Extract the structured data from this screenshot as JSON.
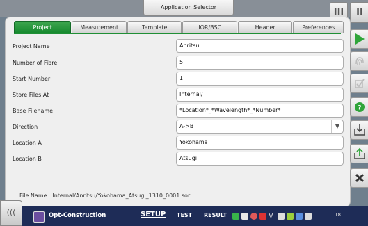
{
  "window": {
    "title": "Application Selector"
  },
  "corner_buttons": [
    {
      "icon": "pause-bars-icon",
      "glyph": "III"
    },
    {
      "icon": "pause-bars-icon",
      "glyph": "II"
    }
  ],
  "tabs": [
    {
      "label": "Project",
      "active": true
    },
    {
      "label": "Measurement",
      "active": false
    },
    {
      "label": "Template",
      "active": false
    },
    {
      "label": "IOR/BSC",
      "active": false
    },
    {
      "label": "Header",
      "active": false
    },
    {
      "label": "Preferences",
      "active": false
    }
  ],
  "fields": [
    {
      "label": "Project Name",
      "value": "Anritsu"
    },
    {
      "label": "Number of Fibre",
      "value": "5"
    },
    {
      "label": "Start Number",
      "value": "1"
    },
    {
      "label": "Store Files At",
      "value": "Internal/"
    },
    {
      "label": "Base Filename",
      "value": "*Location*_*Wavelength*_*Number*"
    },
    {
      "label": "Direction",
      "value": "A->B",
      "dropdown": true
    },
    {
      "label": "Location A",
      "value": "Yokohama"
    },
    {
      "label": "Location B",
      "value": "Atsugi"
    }
  ],
  "file_name": {
    "label": "File Name :",
    "value": "Internal/Anritsu/Yokohama_Atsugi_1310_0001.sor"
  },
  "sidebar": [
    "play-icon",
    "fingerprint-icon",
    "checklist-icon",
    "help-icon",
    "save-icon",
    "export-icon",
    "close-icon"
  ],
  "bottom": {
    "collapse_label": "(((",
    "app_name": "Opt-Construction",
    "nav": [
      {
        "label": "SETUP",
        "active": true
      },
      {
        "label": "TEST",
        "active": false
      },
      {
        "label": "RESULT",
        "active": false
      }
    ],
    "tray_icons": [
      "battery-icon",
      "camera-icon",
      "wifi-icon",
      "usb-icon",
      "v-icon",
      "terminal-icon",
      "network-icon",
      "display-icon",
      "speaker-icon"
    ],
    "clock": "18",
    "colors": {
      "bar": "#1e2c57",
      "accent": "#178a2f"
    }
  }
}
